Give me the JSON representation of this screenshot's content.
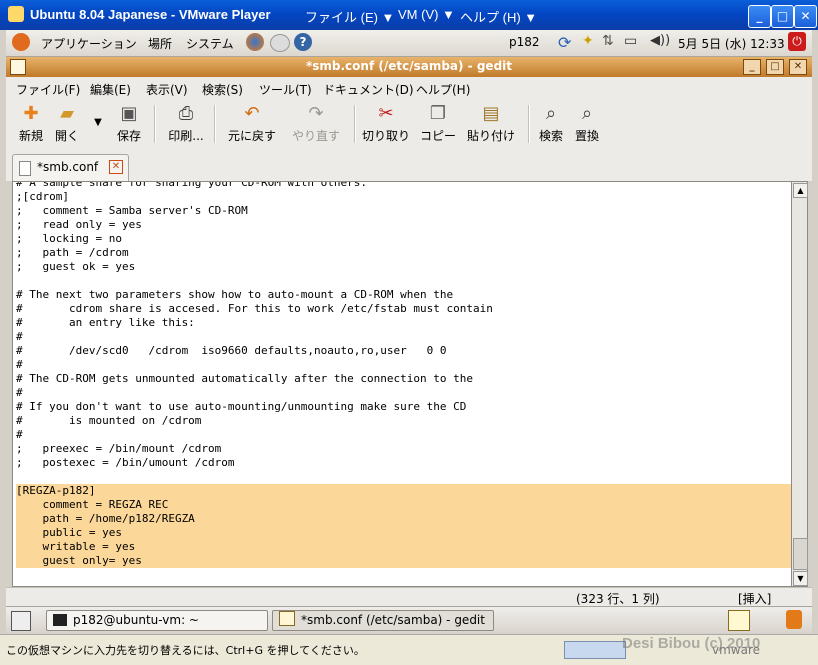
{
  "vmware": {
    "title": "Ubuntu 8.04 Japanese - VMware Player",
    "menus": [
      "ファイル (E) ▼",
      "VM (V) ▼",
      "ヘルプ (H) ▼"
    ],
    "status_text": "この仮想マシンに入力先を切り替えるには、Ctrl+G を押してください。",
    "watermark": "Desi Bibou (c) 2010",
    "vmware_logo": "vmware"
  },
  "panel": {
    "menus": [
      "アプリケーション",
      "場所",
      "システム"
    ],
    "username": "p182",
    "clock": "5月 5日 (水) 12:33"
  },
  "gedit": {
    "title": "*smb.conf (/etc/samba) - gedit",
    "menus": [
      "ファイル(F)",
      "編集(E)",
      "表示(V)",
      "検索(S)",
      "ツール(T)",
      "ドキュメント(D)",
      "ヘルプ(H)"
    ],
    "toolbar": [
      "新規",
      "開く",
      "保存",
      "印刷...",
      "元に戻す",
      "やり直す",
      "切り取り",
      "コピー",
      "貼り付け",
      "検索",
      "置換"
    ],
    "tab_label": "*smb.conf",
    "status_position": "(323 行、1 列)",
    "status_mode": "[挿入]"
  },
  "editor": {
    "lines": [
      "# A sample share for sharing your CD-ROM with others.",
      ";[cdrom]",
      ";   comment = Samba server's CD-ROM",
      ";   read only = yes",
      ";   locking = no",
      ";   path = /cdrom",
      ";   guest ok = yes",
      "",
      "# The next two parameters show how to auto-mount a CD-ROM when the",
      "#       cdrom share is accesed. For this to work /etc/fstab must contain",
      "#       an entry like this:",
      "#",
      "#       /dev/scd0   /cdrom  iso9660 defaults,noauto,ro,user   0 0",
      "#",
      "# The CD-ROM gets unmounted automatically after the connection to the",
      "#",
      "# If you don't want to use auto-mounting/unmounting make sure the CD",
      "#       is mounted on /cdrom",
      "#",
      ";   preexec = /bin/mount /cdrom",
      ";   postexec = /bin/umount /cdrom",
      "",
      "[REGZA-p182]",
      "    comment = REGZA REC",
      "    path = /home/p182/REGZA",
      "    public = yes",
      "    writable = yes",
      "    guest only= yes"
    ]
  },
  "taskbar": {
    "terminal_task": "p182@ubuntu-vm: ~",
    "gedit_task": "*smb.conf (/etc/samba) - gedit"
  }
}
